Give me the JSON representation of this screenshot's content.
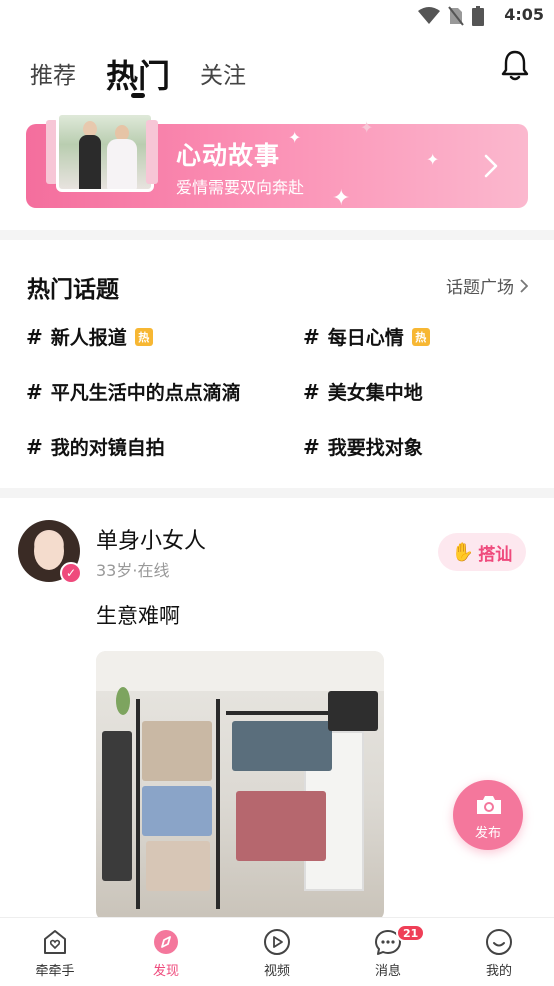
{
  "status_bar": {
    "time": "4:05"
  },
  "top_tabs": [
    {
      "label": "推荐",
      "active": false
    },
    {
      "label": "热门",
      "active": true
    },
    {
      "label": "关注",
      "active": false
    }
  ],
  "banner": {
    "title": "心动故事",
    "subtitle": "爱情需要双向奔赴"
  },
  "topics": {
    "title": "热门话题",
    "link_label": "话题广场",
    "hot_badge": "热",
    "hash_symbol": "#",
    "items": [
      {
        "label": "新人报道",
        "hot": true
      },
      {
        "label": "每日心情",
        "hot": true
      },
      {
        "label": "平凡生活中的点点滴滴",
        "hot": false
      },
      {
        "label": "美女集中地",
        "hot": false
      },
      {
        "label": "我的对镜自拍",
        "hot": false
      },
      {
        "label": "我要找对象",
        "hot": false
      }
    ]
  },
  "post": {
    "name": "单身小女人",
    "meta": "33岁·在线",
    "chat_button": "搭讪",
    "text": "生意难啊"
  },
  "fab": {
    "label": "发布"
  },
  "bottom_nav": [
    {
      "label": "牵牵手",
      "icon": "heart-house-icon",
      "active": false
    },
    {
      "label": "发现",
      "icon": "compass-icon",
      "active": true
    },
    {
      "label": "视频",
      "icon": "play-icon",
      "active": false
    },
    {
      "label": "消息",
      "icon": "chat-icon",
      "active": false,
      "badge": "21"
    },
    {
      "label": "我的",
      "icon": "smile-icon",
      "active": false
    }
  ],
  "colors": {
    "accent": "#ef4a7c",
    "banner_start": "#f46e9d",
    "hot_badge": "#f7b733"
  }
}
